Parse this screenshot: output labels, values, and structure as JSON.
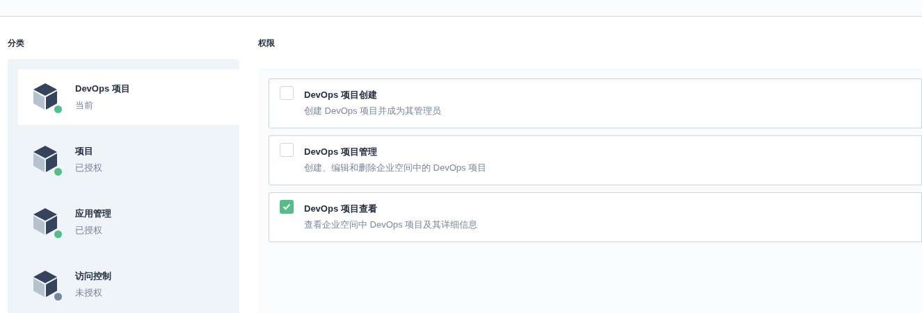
{
  "categories": {
    "heading": "分类",
    "items": [
      {
        "name": "DevOps 项目",
        "status": "当前",
        "color": "#55bc8a",
        "selected": true
      },
      {
        "name": "项目",
        "status": "已授权",
        "color": "#55bc8a",
        "selected": false
      },
      {
        "name": "应用管理",
        "status": "已授权",
        "color": "#55bc8a",
        "selected": false
      },
      {
        "name": "访问控制",
        "status": "未授权",
        "color": "#79879c",
        "selected": false
      }
    ]
  },
  "permissions": {
    "heading": "权限",
    "items": [
      {
        "title": "DevOps 项目创建",
        "description": "创建 DevOps 项目并成为其管理员",
        "checked": false
      },
      {
        "title": "DevOps 项目管理",
        "description": "创建、编辑和删除企业空间中的 DevOps 项目",
        "checked": false
      },
      {
        "title": "DevOps 项目查看",
        "description": "查看企业空间中 DevOps 项目及其详细信息",
        "checked": true
      }
    ]
  }
}
